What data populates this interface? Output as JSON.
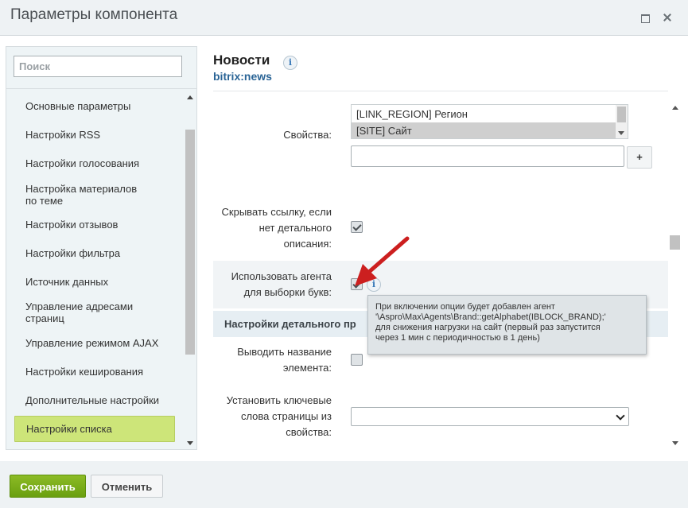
{
  "window": {
    "title": "Параметры компонента",
    "maximize_icon": "maximize-icon",
    "close_icon": "close-icon"
  },
  "sidebar": {
    "search_placeholder": "Поиск",
    "items": [
      {
        "label": "Основные параметры"
      },
      {
        "label": "Настройки RSS"
      },
      {
        "label": "Настройки голосования"
      },
      {
        "label": "Настройка материалов по теме"
      },
      {
        "label": "Настройки отзывов"
      },
      {
        "label": "Настройки фильтра"
      },
      {
        "label": "Источник данных"
      },
      {
        "label": "Управление адресами страниц"
      },
      {
        "label": "Управление режимом AJAX"
      },
      {
        "label": "Настройки кеширования"
      },
      {
        "label": "Дополнительные настройки"
      },
      {
        "label": "Настройки списка",
        "active": true
      }
    ],
    "active_color": "#cde579"
  },
  "component": {
    "title": "Новости",
    "code": "bitrix:news"
  },
  "form": {
    "properties_label": "Свойства:",
    "properties_options": [
      "[LINK_REGION] Регион",
      "[SITE] Сайт"
    ],
    "properties_selected": "[SITE] Сайт",
    "add_button_label": "+",
    "hide_link_label": [
      "Скрывать ссылку, если",
      "нет детального",
      "описания:"
    ],
    "hide_link_checked": true,
    "use_agent_label": [
      "Использовать агента",
      "для выборки букв:"
    ],
    "use_agent_checked": true,
    "section_detail": "Настройки детального пр",
    "show_name_label": [
      "Выводить название",
      "элемента:"
    ],
    "show_name_checked": false,
    "keywords_label": [
      "Установить ключевые",
      "слова страницы из",
      "свойства:"
    ],
    "keywords_value": ""
  },
  "tooltip": {
    "lines": [
      "При включении опции будет добавлен агент",
      "'\\Aspro\\Max\\Agents\\Brand::getAlphabet(IBLOCK_BRAND);'",
      "для снижения нагрузки на сайт (первый раз запустится",
      "через 1 мин с периодичностью в 1 день)"
    ]
  },
  "footer": {
    "save_label": "Сохранить",
    "cancel_label": "Отменить"
  },
  "colors": {
    "save_button": "#76aa14",
    "arrow": "#cc1f1f",
    "link": "#2a6496"
  }
}
